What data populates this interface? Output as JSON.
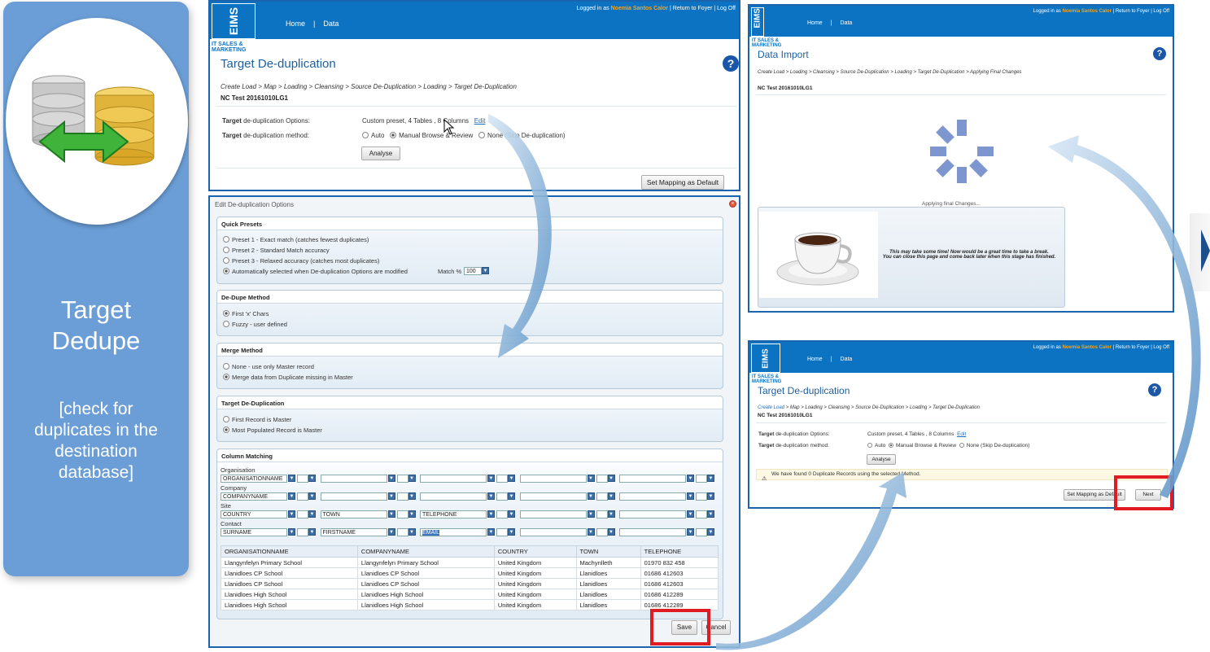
{
  "card": {
    "title_line1": "Target",
    "title_line2": "Dedupe",
    "subtitle_lines": [
      "[check for",
      "duplicates in the",
      "destination",
      "database]"
    ]
  },
  "app": {
    "logo": "EIMS",
    "logo_sub1": "IT SALES &",
    "logo_sub2": "MARKETING",
    "nav_home": "Home",
    "nav_data": "Data",
    "login_prefix": "Logged in as",
    "user": "Noemia Santos Calor",
    "return_link": "Return to Foyer",
    "logout_link": "Log Off",
    "separator": "|"
  },
  "panel_a": {
    "title": "Target De-duplication",
    "breadcrumb": "Create Load > Map > Loading > Cleansing > Source De-Duplication > Loading > Target De-Duplication",
    "load_name": "NC Test 20161010LG1",
    "options_label_bold": "Target",
    "options_label_rest": " de-duplication Options:",
    "options_value": "Custom preset, 4 Tables , 8 Columns",
    "edit_link": "Edit",
    "method_label_bold": "Target",
    "method_label_rest": " de-duplication method:",
    "method_auto": "Auto",
    "method_manual": "Manual Browse & Review",
    "method_none": "None (Skip De-duplication)",
    "analyse_button": "Analyse",
    "default_button": "Set Mapping as Default"
  },
  "dialog": {
    "title": "Edit De-duplication Options",
    "quick_presets": {
      "heading": "Quick Presets",
      "options": [
        "Preset 1 - Exact match (catches fewest duplicates)",
        "Preset 2 - Standard Match accuracy",
        "Preset 3 - Relaxed accuracy (catches most duplicates)",
        "Automatically selected when De-duplication Options are modified"
      ],
      "match_label": "Match %",
      "match_value": "100"
    },
    "dedupe_method": {
      "heading": "De-Dupe Method",
      "options": [
        "First 'x' Chars",
        "Fuzzy - user defined"
      ]
    },
    "merge_method": {
      "heading": "Merge Method",
      "options": [
        "None - use only Master record",
        "Merge data from Duplicate missing in Master"
      ]
    },
    "target_dedup": {
      "heading": "Target De-Duplication",
      "options": [
        "First Record is Master",
        "Most Populated Record is Master"
      ]
    },
    "column_matching": {
      "heading": "Column Matching",
      "rows": [
        {
          "label": "Organisation",
          "fields": [
            "ORGANISATIONNAME",
            "",
            "",
            "",
            ""
          ]
        },
        {
          "label": "Company",
          "fields": [
            "COMPANYNAME",
            "",
            "",
            "",
            ""
          ]
        },
        {
          "label": "Site",
          "fields": [
            "COUNTRY",
            "TOWN",
            "TELEPHONE",
            "",
            ""
          ]
        },
        {
          "label": "Contact",
          "fields": [
            "SURNAME",
            "FIRSTNAME",
            "EMAIL",
            "",
            ""
          ]
        }
      ]
    },
    "table": {
      "headers": [
        "ORGANISATIONNAME",
        "COMPANYNAME",
        "COUNTRY",
        "TOWN",
        "TELEPHONE"
      ],
      "rows": [
        [
          "Llangynfelyn Primary School",
          "Llangynfelyn Primary School",
          "United Kingdom",
          "Machynlleth",
          "01970 832 458"
        ],
        [
          "Llanidloes CP School",
          "Llanidloes CP School",
          "United Kingdom",
          "Llanidloes",
          "01686 412603"
        ],
        [
          "Llanidloes CP School",
          "Llanidloes CP School",
          "United Kingdom",
          "Llanidloes",
          "01686 412603"
        ],
        [
          "Llanidloes High School",
          "Llanidloes High School",
          "United Kingdom",
          "Llanidloes",
          "01686 412289"
        ],
        [
          "Llanidloes High School",
          "Llanidloes High School",
          "United Kingdom",
          "Llanidloes",
          "01686 412289"
        ]
      ]
    },
    "save_button": "Save",
    "cancel_button": "Cancel"
  },
  "panel_b": {
    "title": "Data Import",
    "breadcrumb": "Create Load > Loading > Cleansing > Source De-Duplication > Loading > Target De-Duplication > Applying Final Changes",
    "load_name": "NC Test 20161010LG1",
    "status": "Applying final Changes...",
    "message_line1": "This may take some time! Now would be a great time to take a break.",
    "message_line2": "You can close this page and come back later when this stage has finished."
  },
  "panel_c": {
    "title": "Target De-duplication",
    "breadcrumb_link": "Create Load",
    "breadcrumb_rest": " > Map > Loading > Cleansing > Source De-Duplication > Loading > Target De-Duplication",
    "load_name": "NC Test 20161010LG1",
    "options_label_bold": "Target",
    "options_label_rest": " de-duplication Options:",
    "options_value": "Custom preset, 4 Tables , 8 Columns",
    "edit_link": "Edit",
    "method_label_bold": "Target",
    "method_label_rest": " de-duplication method:",
    "method_auto": "Auto",
    "method_manual": "Manual Browse & Review",
    "method_none": "None (Skip De-duplication)",
    "analyse_button": "Analyse",
    "warning": "We have found 0 Duplicate Records using the selected Method.",
    "default_button": "Set Mapping as Default",
    "next_button": "Next"
  },
  "colors": {
    "brand_blue": "#0b73c1",
    "card_blue": "#6b9ed7",
    "highlight_red": "#e01b22",
    "user_orange": "#f7a21b"
  }
}
